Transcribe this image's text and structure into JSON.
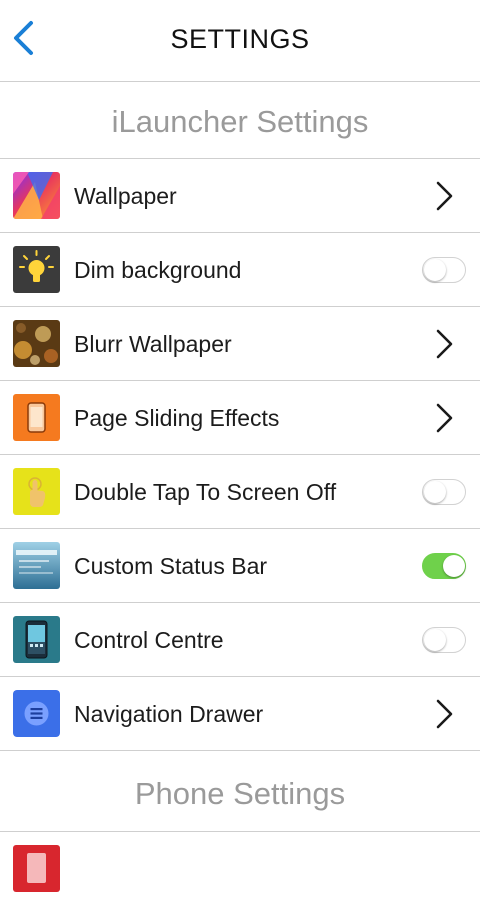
{
  "header": {
    "title": "SETTINGS",
    "back_icon": "chevron-left-icon",
    "accent_color": "#1a7fd6"
  },
  "sections": [
    {
      "title": "iLauncher Settings",
      "items": [
        {
          "label": "Wallpaper",
          "icon": "wallpaper-icon",
          "control": "chevron"
        },
        {
          "label": "Dim background",
          "icon": "lightbulb-icon",
          "control": "toggle",
          "value": false
        },
        {
          "label": "Blurr Wallpaper",
          "icon": "blur-wallpaper-icon",
          "control": "chevron"
        },
        {
          "label": "Page Sliding Effects",
          "icon": "phone-icon",
          "control": "chevron"
        },
        {
          "label": "Double Tap To Screen Off",
          "icon": "tap-hand-icon",
          "control": "toggle",
          "value": false
        },
        {
          "label": "Custom Status Bar",
          "icon": "status-bar-icon",
          "control": "toggle",
          "value": true
        },
        {
          "label": "Control Centre",
          "icon": "control-centre-icon",
          "control": "toggle",
          "value": false
        },
        {
          "label": "Navigation Drawer",
          "icon": "menu-icon",
          "control": "chevron"
        }
      ]
    },
    {
      "title": "Phone Settings",
      "items": []
    }
  ],
  "colors": {
    "toggle_on": "#6fd14b",
    "section_header_text": "#9a9a9a",
    "divider": "#cfcfcf"
  }
}
